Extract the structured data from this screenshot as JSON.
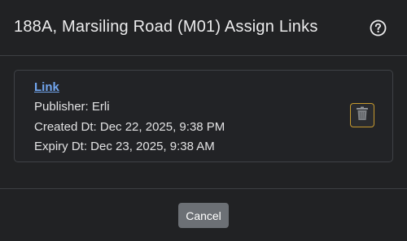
{
  "modal": {
    "title": "188A, Marsiling Road (M01) Assign Links",
    "help_icon": "question-circle-icon"
  },
  "link_card": {
    "link_label": "Link",
    "publisher": "Publisher: Erli",
    "created": "Created Dt: Dec 22, 2025, 9:38 PM",
    "expiry": "Expiry Dt: Dec 23, 2025, 9:38 AM",
    "delete_icon": "trash-icon"
  },
  "footer": {
    "cancel_label": "Cancel"
  },
  "colors": {
    "background": "#212224",
    "link": "#72a6ef",
    "delete_border": "#c79a2e",
    "cancel_button": "#6c7075"
  }
}
